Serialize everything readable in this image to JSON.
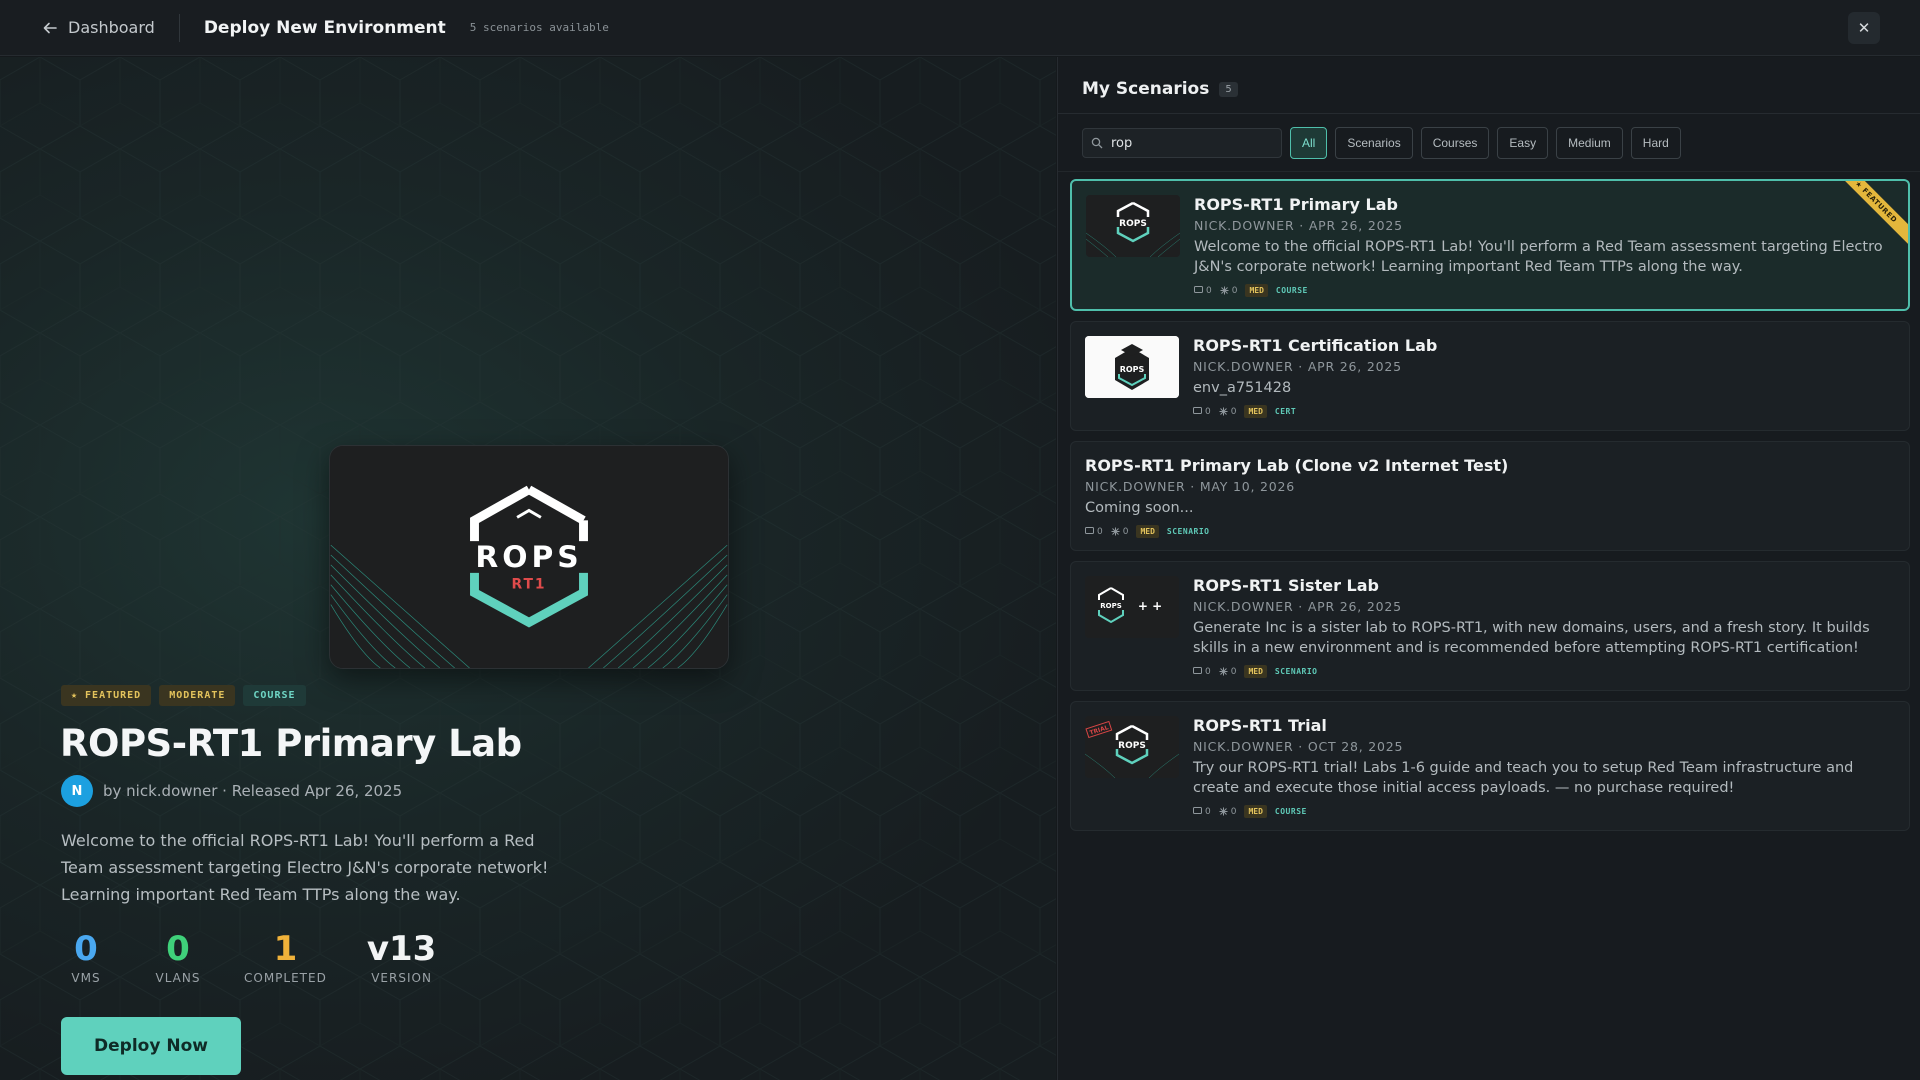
{
  "topbar": {
    "back_label": "Dashboard",
    "title": "Deploy New Environment",
    "subtitle": "5 scenarios available",
    "close_glyph": "✕"
  },
  "hero": {
    "badges": [
      "★ FEATURED",
      "MODERATE",
      "COURSE"
    ],
    "title": "ROPS-RT1 Primary Lab",
    "avatar_initial": "N",
    "byline": "by nick.downer · Released Apr 26, 2025",
    "description": "Welcome to the official ROPS-RT1 Lab! You'll perform a Red Team assessment targeting Electro J&N's corporate network! Learning important Red Team TTPs along the way.",
    "stats": [
      {
        "value": "0",
        "label": "VMS",
        "color": "#4aa8f0"
      },
      {
        "value": "0",
        "label": "VLANS",
        "color": "#3fd07a"
      },
      {
        "value": "1",
        "label": "COMPLETED",
        "color": "#f0b23a"
      },
      {
        "value": "v13",
        "label": "VERSION",
        "color": "#f2f4f5"
      }
    ],
    "deploy_label": "Deploy Now",
    "logo_text": "ROPS",
    "logo_sub": "RT1"
  },
  "panel": {
    "title": "My Scenarios",
    "count": "5",
    "search_value": "rop",
    "filters": [
      "All",
      "Scenarios",
      "Courses",
      "Easy",
      "Medium",
      "Hard"
    ],
    "active_filter": "All",
    "items": [
      {
        "title": "ROPS-RT1 Primary Lab",
        "meta": "NICK.DOWNER · APR 26, 2025",
        "desc": "Welcome to the official ROPS-RT1 Lab! You'll perform a Red Team assessment targeting Electro J&N's corporate network! Learning important Red Team TTPs along the way.",
        "comments": "0",
        "stars": "0",
        "level": "MED",
        "type": "COURSE",
        "ribbon": "★ FEATURED",
        "thumb_icon": "rops-logo-icon"
      },
      {
        "title": "ROPS-RT1 Certification Lab",
        "meta": "NICK.DOWNER · APR 26, 2025",
        "desc": "env_a751428",
        "comments": "0",
        "stars": "0",
        "level": "MED",
        "type": "CERT",
        "thumb_icon": "rops-cert-logo-icon"
      },
      {
        "title": "ROPS-RT1 Primary Lab (Clone v2 Internet Test)",
        "meta": "NICK.DOWNER · MAY 10, 2026",
        "desc": "Coming soon...",
        "comments": "0",
        "stars": "0",
        "level": "MED",
        "type": "SCENARIO"
      },
      {
        "title": "ROPS-RT1 Sister Lab",
        "meta": "NICK.DOWNER · APR 26, 2025",
        "desc": "Generate Inc is a sister lab to ROPS-RT1, with new domains, users, and a fresh story. It builds skills in a new environment and is recommended before attempting ROPS-RT1 certification!",
        "comments": "0",
        "stars": "0",
        "level": "MED",
        "type": "SCENARIO",
        "thumb_icon": "rops-plus-logo-icon",
        "thumb_extra": "+ +"
      },
      {
        "title": "ROPS-RT1 Trial",
        "meta": "NICK.DOWNER · OCT 28, 2025",
        "desc": "Try our ROPS-RT1 trial! Labs 1-6 guide and teach you to setup Red Team infrastructure and create and execute those initial access payloads. — no purchase required!",
        "comments": "0",
        "stars": "0",
        "level": "MED",
        "type": "COURSE",
        "thumb_icon": "rops-trial-logo-icon",
        "thumb_extra": "TRIAL"
      }
    ]
  }
}
